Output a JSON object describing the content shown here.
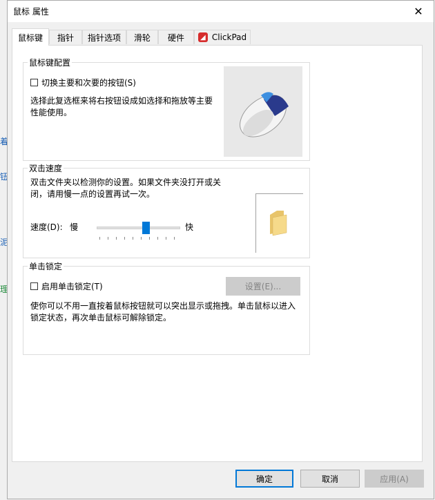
{
  "window": {
    "title": "鼠标 属性",
    "close_glyph": "✕"
  },
  "tabs": [
    {
      "label": "鼠标键"
    },
    {
      "label": "指针"
    },
    {
      "label": "指针选项"
    },
    {
      "label": "滑轮"
    },
    {
      "label": "硬件"
    },
    {
      "label": "ClickPad"
    }
  ],
  "buttons_config": {
    "group_title": "鼠标键配置",
    "switch_checkbox_label": "切换主要和次要的按钮(S)",
    "switch_checked": false,
    "description": "选择此复选框来将右按钮设成如选择和拖放等主要性能使用。"
  },
  "double_click": {
    "group_title": "双击速度",
    "description": "双击文件夹以检测你的设置。如果文件夹没打开或关闭，请用慢一点的设置再试一次。",
    "speed_label": "速度(D):",
    "slow_label": "慢",
    "fast_label": "快",
    "speed_level_fraction": 0.6
  },
  "click_lock": {
    "group_title": "单击锁定",
    "checkbox_label": "启用单击锁定(T)",
    "checked": false,
    "settings_button": "设置(E)...",
    "description": "使你可以不用一直按着鼠标按钮就可以突出显示或拖拽。单击鼠标以进入锁定状态，再次单击鼠标可解除锁定。"
  },
  "footer": {
    "ok": "确定",
    "cancel": "取消",
    "apply": "应用(A)"
  },
  "left_edge_chars": [
    "着",
    "钮",
    "泥",
    "理"
  ],
  "colors": {
    "accent": "#0078d7",
    "clickpad_icon": "#d62d2d"
  }
}
